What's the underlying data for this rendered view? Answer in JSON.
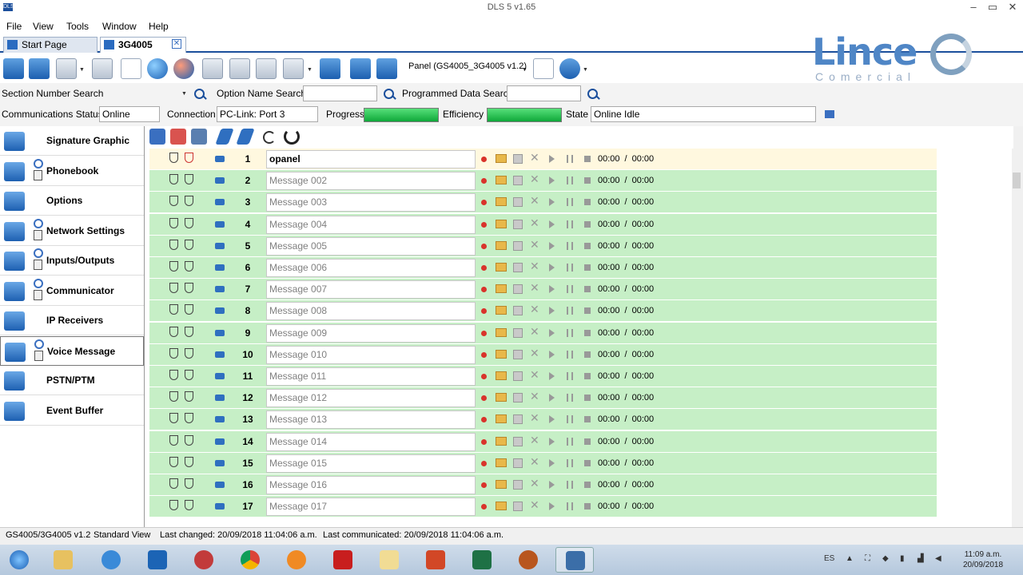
{
  "window": {
    "title": "DLS 5 v1.65",
    "app_icon": "DLS"
  },
  "menu": [
    "File",
    "View",
    "Tools",
    "Window",
    "Help"
  ],
  "tabs": [
    {
      "label": "Start Page"
    },
    {
      "label": "3G4005"
    }
  ],
  "toolbar": {
    "panel_selector": "Panel (GS4005_3G4005 v1.2)"
  },
  "logo": {
    "title": "Lince",
    "subtitle": "Comercial"
  },
  "search": {
    "section_label": "Section Number Search",
    "option_label": "Option Name Search",
    "option_value": "",
    "programmed_label": "Programmed Data Search",
    "programmed_value": ""
  },
  "status_row": {
    "comm_status_label": "Communications Status",
    "comm_status_value": "Online",
    "connection_label": "Connection",
    "connection_value": "PC-Link: Port 3",
    "progress_label": "Progress",
    "progress": 1.0,
    "efficiency_label": "Efficiency",
    "efficiency": 1.0,
    "state_label": "State",
    "state_value": "Online Idle"
  },
  "sidebar": [
    {
      "label": "Signature Graphic",
      "icon": "waveform-icon",
      "locked": false
    },
    {
      "label": "Phonebook",
      "icon": "phonebook-icon",
      "locked": true
    },
    {
      "label": "Options",
      "icon": "gears-icon",
      "locked": false
    },
    {
      "label": "Network Settings",
      "icon": "network-icon",
      "locked": true
    },
    {
      "label": "Inputs/Outputs",
      "icon": "io-icon",
      "locked": true
    },
    {
      "label": "Communicator",
      "icon": "communicator-icon",
      "locked": true
    },
    {
      "label": "IP Receivers",
      "icon": "wifi-icon",
      "locked": false
    },
    {
      "label": "Voice Message",
      "icon": "microphone-icon",
      "locked": true,
      "selected": true
    },
    {
      "label": "PSTN/PTM",
      "icon": "pstn-icon",
      "locked": false
    },
    {
      "label": "Event Buffer",
      "icon": "event-buffer-icon",
      "locked": false
    }
  ],
  "messages": [
    {
      "num": "1",
      "text": "opanel",
      "time": "00:00",
      "total": "00:00"
    },
    {
      "num": "2",
      "text": "Message 002",
      "time": "00:00",
      "total": "00:00"
    },
    {
      "num": "3",
      "text": "Message 003",
      "time": "00:00",
      "total": "00:00"
    },
    {
      "num": "4",
      "text": "Message 004",
      "time": "00:00",
      "total": "00:00"
    },
    {
      "num": "5",
      "text": "Message 005",
      "time": "00:00",
      "total": "00:00"
    },
    {
      "num": "6",
      "text": "Message 006",
      "time": "00:00",
      "total": "00:00"
    },
    {
      "num": "7",
      "text": "Message 007",
      "time": "00:00",
      "total": "00:00"
    },
    {
      "num": "8",
      "text": "Message 008",
      "time": "00:00",
      "total": "00:00"
    },
    {
      "num": "9",
      "text": "Message 009",
      "time": "00:00",
      "total": "00:00"
    },
    {
      "num": "10",
      "text": "Message 010",
      "time": "00:00",
      "total": "00:00"
    },
    {
      "num": "11",
      "text": "Message 011",
      "time": "00:00",
      "total": "00:00"
    },
    {
      "num": "12",
      "text": "Message 012",
      "time": "00:00",
      "total": "00:00"
    },
    {
      "num": "13",
      "text": "Message 013",
      "time": "00:00",
      "total": "00:00"
    },
    {
      "num": "14",
      "text": "Message 014",
      "time": "00:00",
      "total": "00:00"
    },
    {
      "num": "15",
      "text": "Message 015",
      "time": "00:00",
      "total": "00:00"
    },
    {
      "num": "16",
      "text": "Message 016",
      "time": "00:00",
      "total": "00:00"
    },
    {
      "num": "17",
      "text": "Message 017",
      "time": "00:00",
      "total": "00:00"
    }
  ],
  "time_separator": "/",
  "statusbar": {
    "version": "GS4005/3G4005 v1.2",
    "view": "Standard View",
    "last_changed": "Last changed: 20/09/2018 11:04:06 a.m.",
    "last_communicated": "Last communicated: 20/09/2018 11:04:06 a.m."
  },
  "taskbar": {
    "apps": [
      "start",
      "explorer",
      "internet-explorer",
      "outlook",
      "snipping-tool",
      "chrome",
      "burner",
      "acrobat",
      "folder",
      "powerpoint",
      "excel",
      "paw-app",
      "dls"
    ],
    "lang": "ES",
    "time": "11:09 a.m.",
    "date": "20/09/2018"
  },
  "colors": {
    "accent": "#1b4f9c",
    "row_green": "#c6efc6",
    "progress_green": "#0fa83a",
    "logo_blue": "#4f86c6"
  }
}
